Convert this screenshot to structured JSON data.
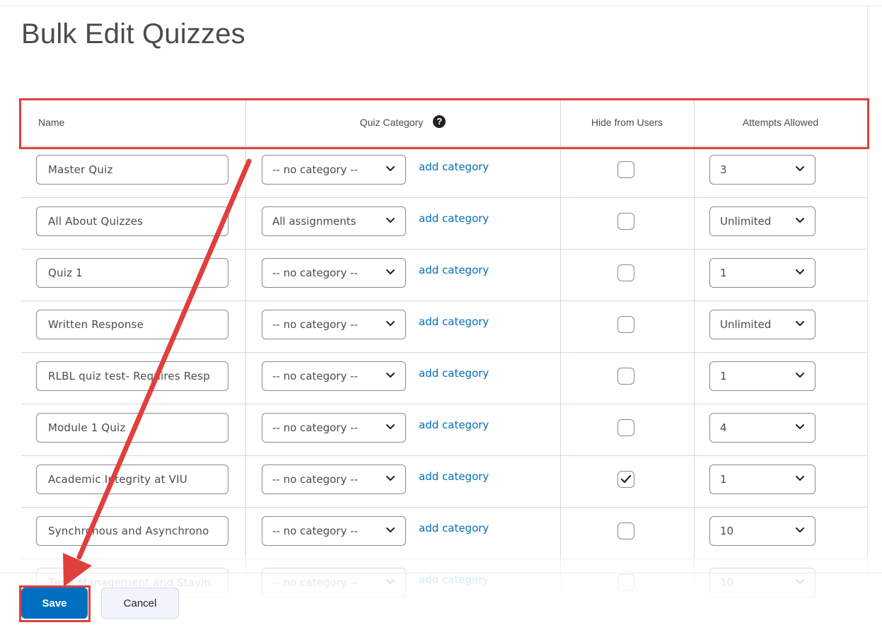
{
  "page": {
    "title": "Bulk Edit Quizzes"
  },
  "columns": {
    "name": "Name",
    "quiz_category": "Quiz Category",
    "hide_from_users": "Hide from Users",
    "attempts_allowed": "Attempts Allowed"
  },
  "rows": [
    {
      "name": "Master Quiz",
      "category": "-- no category --",
      "add_link": "add category",
      "hidden": false,
      "attempts": "3"
    },
    {
      "name": "All About Quizzes",
      "category": "All assignments",
      "add_link": "add category",
      "hidden": false,
      "attempts": "Unlimited"
    },
    {
      "name": "Quiz 1",
      "category": "-- no category --",
      "add_link": "add category",
      "hidden": false,
      "attempts": "1"
    },
    {
      "name": "Written Response",
      "category": "-- no category --",
      "add_link": "add category",
      "hidden": false,
      "attempts": "Unlimited"
    },
    {
      "name": "RLBL quiz test- Requires Resp",
      "category": "-- no category --",
      "add_link": "add category",
      "hidden": false,
      "attempts": "1"
    },
    {
      "name": "Module 1 Quiz",
      "category": "-- no category --",
      "add_link": "add category",
      "hidden": false,
      "attempts": "4"
    },
    {
      "name": "Academic Integrity at VIU",
      "category": "-- no category --",
      "add_link": "add category",
      "hidden": true,
      "attempts": "1"
    },
    {
      "name": "Synchronous and Asynchrono",
      "category": "-- no category --",
      "add_link": "add category",
      "hidden": false,
      "attempts": "10"
    },
    {
      "name": "Time Management and Stayin",
      "category": "-- no category --",
      "add_link": "add category",
      "hidden": false,
      "attempts": "10"
    }
  ],
  "actions": {
    "save_label": "Save",
    "cancel_label": "Cancel"
  },
  "icons": {
    "help": "help-circle-icon",
    "chevron": "chevron-down-icon",
    "check": "checkmark-icon"
  },
  "colors": {
    "primary": "#006fbf",
    "link": "#006fbf",
    "annotation": "#e0403c"
  }
}
